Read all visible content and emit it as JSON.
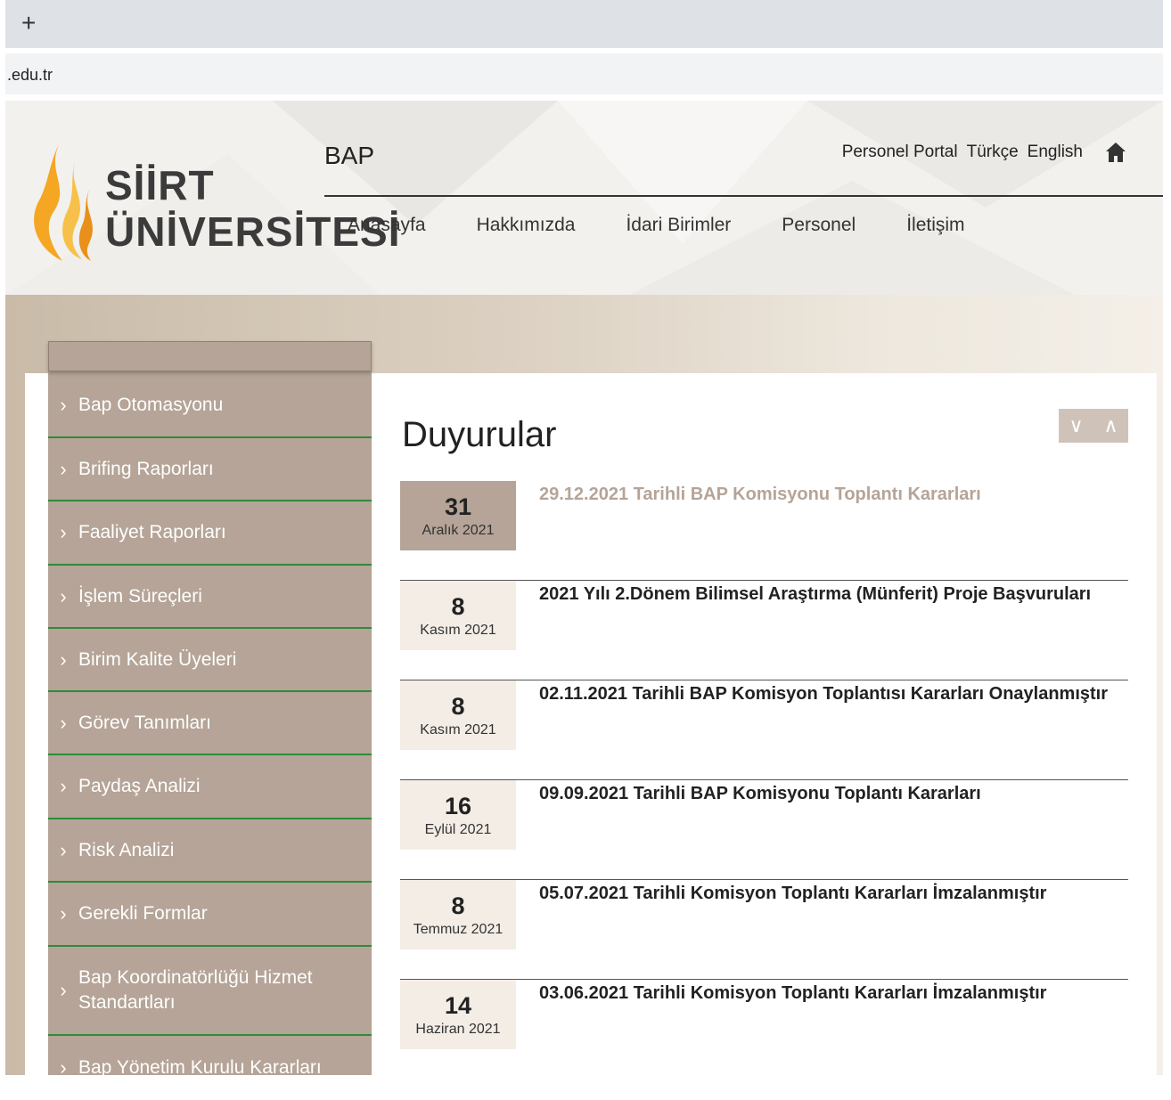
{
  "browser": {
    "tab_plus": "+",
    "url": ".edu.tr"
  },
  "logo": {
    "line1": "SİİRT",
    "line2": "ÜNİVERSİTESİ"
  },
  "site": {
    "title": "BAP"
  },
  "topnav": {
    "portal": "Personel Portal",
    "turkish": "Türkçe",
    "english": "English",
    "home_icon": "home-icon"
  },
  "mainnav": [
    "Anasayfa",
    "Hakkımızda",
    "İdari Birimler",
    "Personel",
    "İletişim"
  ],
  "sidebar": [
    "Bap Otomasyonu",
    "Brifing Raporları",
    "Faaliyet Raporları",
    "İşlem Süreçleri",
    "Birim Kalite Üyeleri",
    "Görev Tanımları",
    "Paydaş Analizi",
    "Risk Analizi",
    "Gerekli Formlar",
    "Bap Koordinatörlüğü Hizmet Standartları",
    "Bap Yönetim Kurulu Kararları"
  ],
  "announcements": {
    "title": "Duyurular",
    "arrow_down": "∨",
    "arrow_up": "∧",
    "items": [
      {
        "day": "31",
        "month": "Aralık 2021",
        "title": "29.12.2021 Tarihli BAP Komisyonu Toplantı Kararları"
      },
      {
        "day": "8",
        "month": "Kasım 2021",
        "title": "2021 Yılı 2.Dönem Bilimsel Araştırma (Münferit) Proje Başvuruları"
      },
      {
        "day": "8",
        "month": "Kasım 2021",
        "title": "02.11.2021 Tarihli BAP Komisyon Toplantısı Kararları Onaylanmıştır"
      },
      {
        "day": "16",
        "month": "Eylül 2021",
        "title": "09.09.2021 Tarihli BAP Komisyonu Toplantı Kararları"
      },
      {
        "day": "8",
        "month": "Temmuz 2021",
        "title": "05.07.2021 Tarihli Komisyon Toplantı Kararları İmzalanmıştır"
      },
      {
        "day": "14",
        "month": "Haziran 2021",
        "title": "03.06.2021 Tarihli Komisyon Toplantı Kararları İmzalanmıştır"
      }
    ]
  },
  "colors": {
    "accent": "#b5a497",
    "sidebar_divider": "#2e8b3a",
    "flame": "#f5a623"
  }
}
